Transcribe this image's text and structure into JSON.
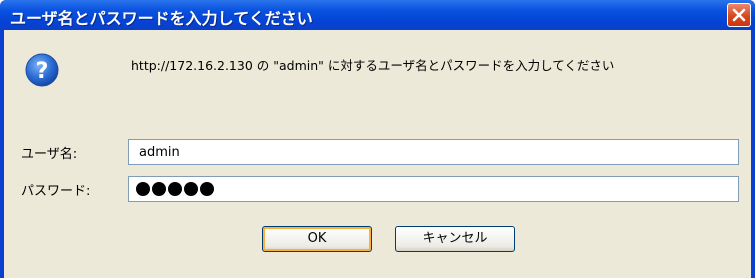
{
  "dialog": {
    "title": "ユーザ名とパスワードを入力してください",
    "message": "http://172.16.2.130 の \"admin\" に対するユーザ名とパスワードを入力してください",
    "icon": "question-icon",
    "colors": {
      "titlebar": "#0a52e0",
      "client": "#ece9d8",
      "close": "#d8481f"
    }
  },
  "form": {
    "username_label": "ユーザ名:",
    "username_value": "admin",
    "password_label": "パスワード:",
    "password_mask_count": 5
  },
  "buttons": {
    "ok_label": "OK",
    "cancel_label": "キャンセル"
  }
}
